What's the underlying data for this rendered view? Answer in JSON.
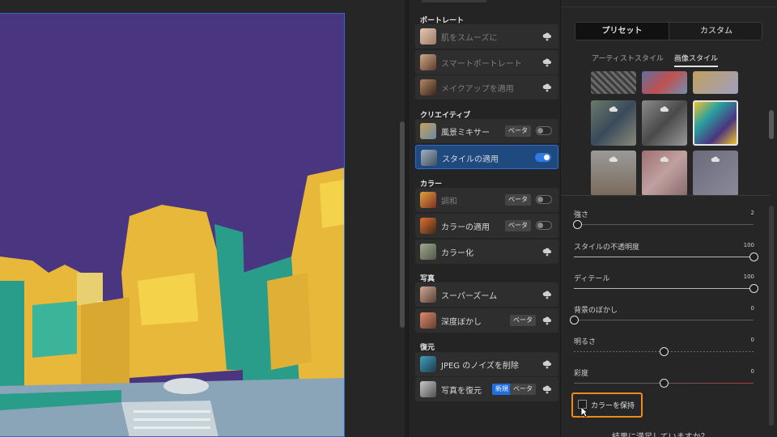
{
  "filters": {
    "sections": [
      {
        "title": "ポートレート",
        "items": [
          {
            "label": "肌をスムーズに",
            "state": "cloud",
            "dim": true
          },
          {
            "label": "スマートポートレート",
            "state": "cloud",
            "dim": true
          },
          {
            "label": "メイクアップを適用",
            "state": "cloud",
            "dim": true
          }
        ]
      },
      {
        "title": "クリエイティブ",
        "items": [
          {
            "label": "風景ミキサー",
            "badge": "ベータ",
            "toggle": "off"
          },
          {
            "label": "スタイルの適用",
            "toggle": "on",
            "active": true
          }
        ]
      },
      {
        "title": "カラー",
        "items": [
          {
            "label": "調和",
            "badge": "ベータ",
            "toggle": "off",
            "dim": true
          },
          {
            "label": "カラーの適用",
            "badge": "ベータ",
            "toggle": "off"
          },
          {
            "label": "カラー化",
            "state": "cloud"
          }
        ]
      },
      {
        "title": "写真",
        "items": [
          {
            "label": "スーパーズーム",
            "state": "cloud"
          },
          {
            "label": "深度ぼかし",
            "badge": "ベータ",
            "state": "cloud"
          }
        ]
      },
      {
        "title": "復元",
        "items": [
          {
            "label": "JPEG のノイズを削除",
            "state": "cloud"
          },
          {
            "label": "写真を復元",
            "badge_new": "新規",
            "badge": "ベータ",
            "state": "cloud"
          }
        ]
      }
    ]
  },
  "style_panel": {
    "tabs": {
      "preset": "プリセット",
      "custom": "カスタム"
    },
    "subtabs": {
      "artist": "アーティストスタイル",
      "image": "画像スタイル"
    },
    "sliders": [
      {
        "label": "強さ",
        "value": "2",
        "fraction": 0.02
      },
      {
        "label": "スタイルの不透明度",
        "value": "100",
        "fraction": 1.0
      },
      {
        "label": "ディテール",
        "value": "100",
        "fraction": 1.0
      },
      {
        "label": "背景のぼかし",
        "value": "0",
        "fraction": 0.0
      },
      {
        "label": "明るさ",
        "value": "0",
        "fraction": 0.5,
        "kind": "bright"
      },
      {
        "label": "彩度",
        "value": "0",
        "fraction": 0.5,
        "kind": "sat"
      }
    ],
    "keep_color_label": "カラーを保持",
    "footer_question": "結果に満足していますか？"
  },
  "colors": {
    "accent": "#2f6bd8",
    "highlight": "#f08a1a"
  }
}
